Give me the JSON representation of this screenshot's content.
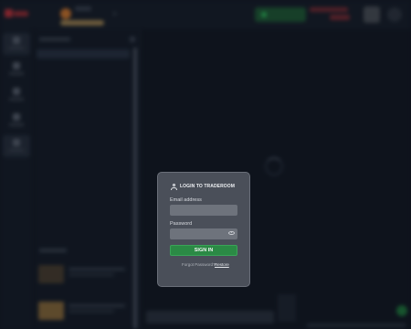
{
  "dialog": {
    "title": "LOGIN TO TRADEROOM",
    "email_label": "Email address",
    "email_value": "",
    "email_placeholder": "",
    "password_label": "Password",
    "password_value": "",
    "password_placeholder": "",
    "signin_label": "SIGN IN",
    "forgot_text": "Forgot Password?",
    "restore_label": "Restore"
  },
  "icons": {
    "dialog_title_icon": "user-icon",
    "password_toggle_icon": "eye-icon"
  },
  "colors": {
    "signin_button": "#2b8a45",
    "dialog_background": "#4a4f59",
    "page_background": "#121722",
    "deposit_button": "#1f5a35",
    "balance_accent": "#7a2a32"
  }
}
